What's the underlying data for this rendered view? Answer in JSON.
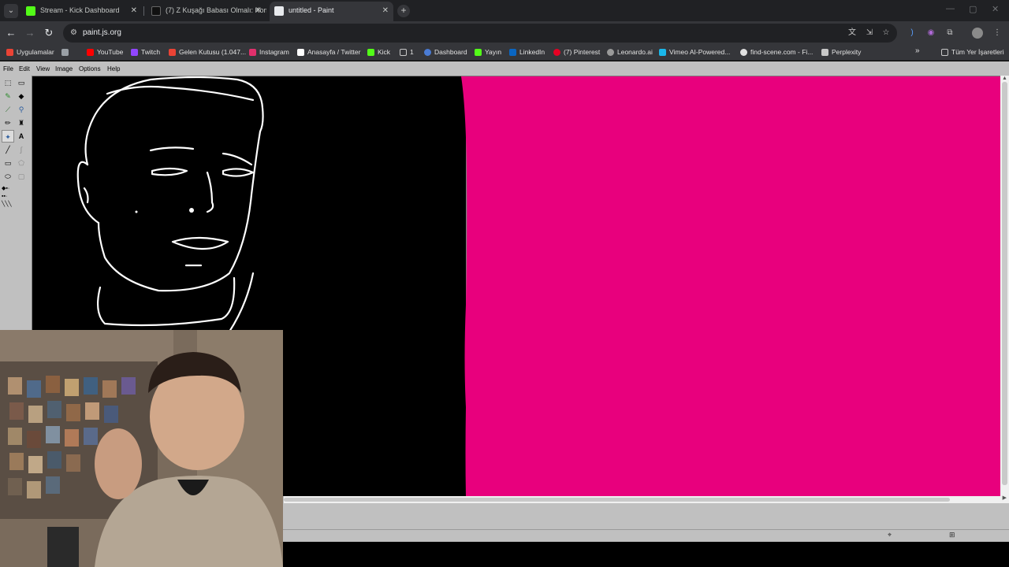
{
  "browser": {
    "tabs": [
      {
        "title": "Stream - Kick Dashboard",
        "favicon": "kick-icon",
        "color": "#53fc18",
        "active": false
      },
      {
        "title": "(7) Z Kuşağı Babası Olmalı: Kom...",
        "favicon": "tiktok-icon",
        "color": "#ffffff",
        "active": false
      },
      {
        "title": "untitled - Paint",
        "favicon": "paint-icon",
        "color": "#e0e0e0",
        "active": true
      }
    ],
    "new_tab": "+",
    "address": "paint.js.org",
    "bookmarks": [
      {
        "label": "Uygulamalar",
        "icon": "apps-grid-icon",
        "color": "#ea4335"
      },
      {
        "label": "",
        "icon": "grid-icon",
        "color": "#9aa0a6"
      },
      {
        "label": "YouTube",
        "icon": "youtube-icon",
        "color": "#ff0000"
      },
      {
        "label": "Twitch",
        "icon": "twitch-icon",
        "color": "#9146ff"
      },
      {
        "label": "Gelen Kutusu (1.047...",
        "icon": "gmail-icon",
        "color": "#ea4335"
      },
      {
        "label": "Instagram",
        "icon": "instagram-icon",
        "color": "#e1306c"
      },
      {
        "label": "Anasayfa / Twitter",
        "icon": "x-icon",
        "color": "#ffffff"
      },
      {
        "label": "Kick",
        "icon": "kick-icon",
        "color": "#53fc18"
      },
      {
        "label": "1",
        "icon": "folder-icon",
        "color": "#c8c8c8"
      },
      {
        "label": "Dashboard",
        "icon": "dashboard-icon",
        "color": "#4a7bd4"
      },
      {
        "label": "Yayın",
        "icon": "kick-icon",
        "color": "#53fc18"
      },
      {
        "label": "LinkedIn",
        "icon": "linkedin-icon",
        "color": "#0a66c2"
      },
      {
        "label": "(7) Pinterest",
        "icon": "pinterest-icon",
        "color": "#e60023"
      },
      {
        "label": "Leonardo.ai",
        "icon": "leonardo-icon",
        "color": "#9a9a9a"
      },
      {
        "label": "Vimeo AI-Powered...",
        "icon": "vimeo-icon",
        "color": "#1ab7ea"
      },
      {
        "label": "find-scene.com - Fi...",
        "icon": "findscene-icon",
        "color": "#e0e0e0"
      },
      {
        "label": "Perplexity",
        "icon": "perplexity-icon",
        "color": "#c8c8c8"
      }
    ],
    "all_bookmarks": "Tüm Yer İşaretleri"
  },
  "paint": {
    "menus": [
      "File",
      "Edit",
      "View",
      "Image",
      "Options",
      "Help"
    ],
    "colors": {
      "canvas_left": "#000000",
      "canvas_right": "#e8007d",
      "stroke": "#ffffff"
    }
  }
}
